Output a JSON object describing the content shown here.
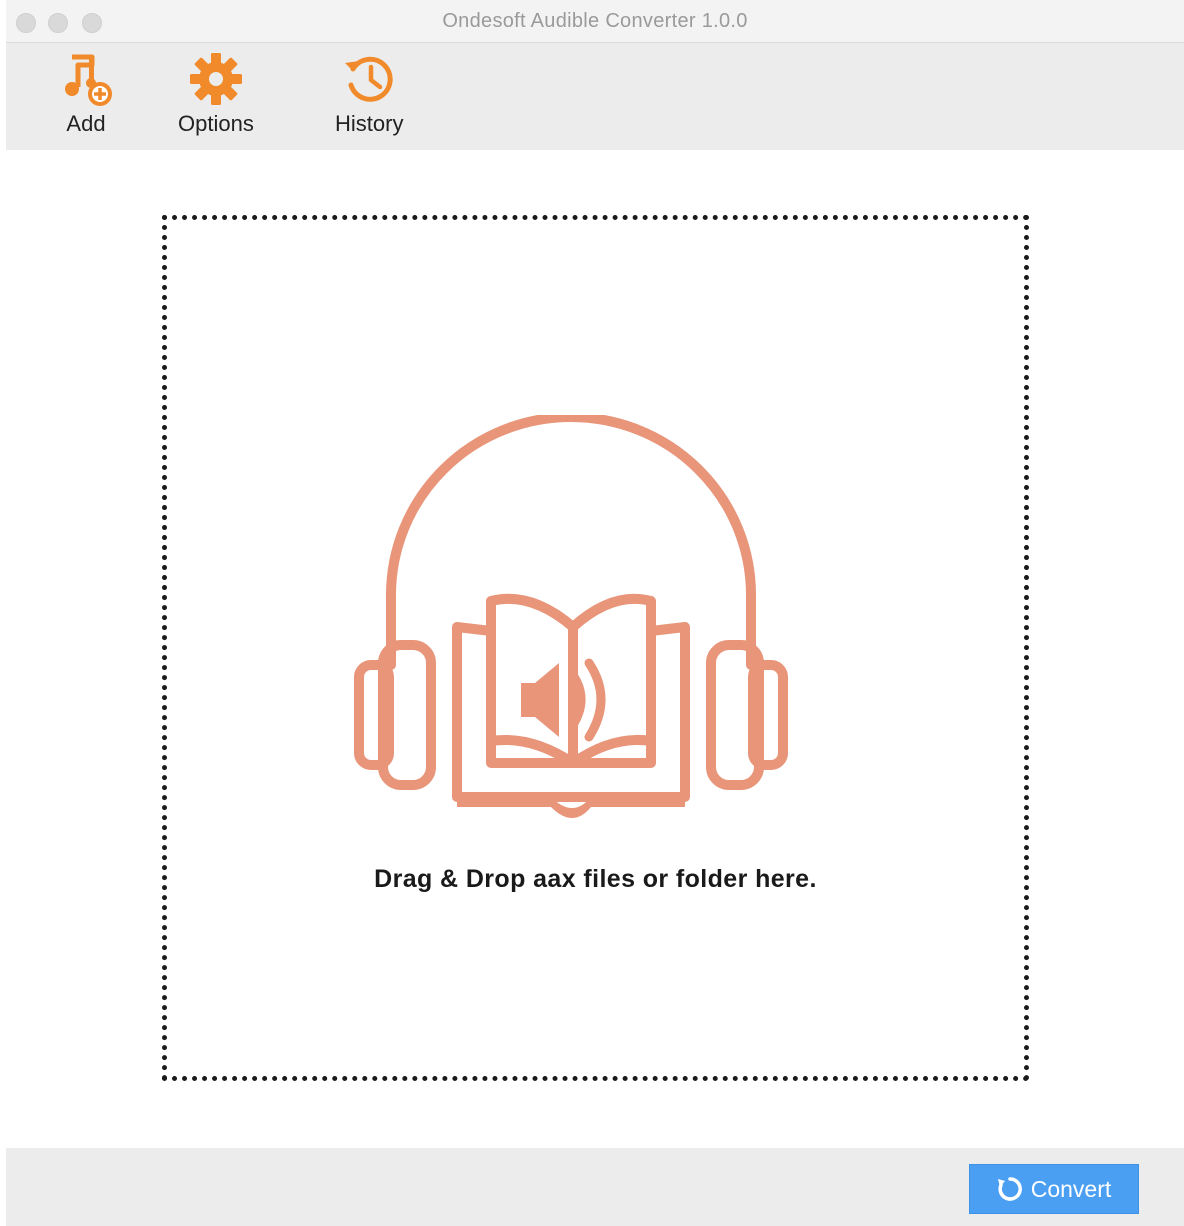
{
  "window": {
    "title": "Ondesoft Audible Converter 1.0.0"
  },
  "toolbar": {
    "items": [
      {
        "label": "Add",
        "icon": "music-add-icon"
      },
      {
        "label": "Options",
        "icon": "gear-icon"
      },
      {
        "label": "History",
        "icon": "history-icon"
      }
    ]
  },
  "dropzone": {
    "text": "Drag & Drop aax files or folder here.",
    "icon": "headphones-audiobook-icon"
  },
  "footer": {
    "convert_label": "Convert",
    "convert_icon": "convert-cycle-icon"
  },
  "colors": {
    "accent_orange": "#f08a2a",
    "illustration": "#e8957a",
    "button_blue": "#4a9ff2"
  }
}
